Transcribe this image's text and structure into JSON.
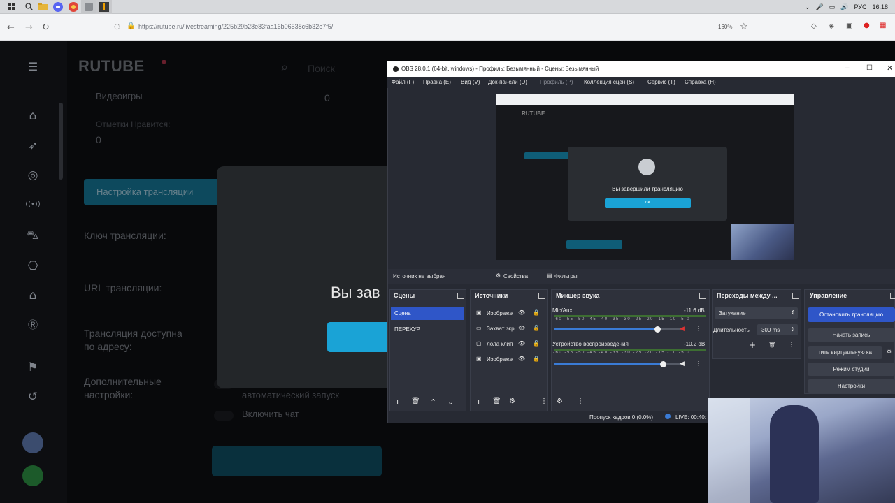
{
  "taskbar": {
    "tray": {
      "lang": "РУС",
      "time": "16:18"
    }
  },
  "browser": {
    "url": "https://rutube.ru/livestreaming/225b29b28e83faa16b06538c6b32e7f5/",
    "zoom": "160%"
  },
  "rutube": {
    "logo": "RUTUBE",
    "search_placeholder": "Поиск",
    "stats": {
      "videogames_label": "Видеоигры",
      "videogames_value": "0",
      "likes_label": "Отметки Нравится:",
      "likes_value": "0"
    },
    "tab_settings": "Настройка трансляции",
    "labels": {
      "key": "Ключ трансляции:",
      "url": "URL трансляции:",
      "address_1": "Трансляция доступна",
      "address_2": "по адресу:",
      "extra_1": "Дополнительные",
      "extra_2": "настройки:"
    },
    "toggles": {
      "autostart": "автоматический запуск",
      "chat": "Включить чат"
    },
    "modal_title": "Вы зав"
  },
  "obs": {
    "title": "OBS 28.0.1 (64-bit, windows) - Профиль: Безымянный - Сцены: Безымянный",
    "menu": [
      "Файл (F)",
      "Правка (E)",
      "Вид (V)",
      "Док-панели (D)",
      "Профиль (P)",
      "Коллекция сцен (S)",
      "Сервис (T)",
      "Справка (H)"
    ],
    "preview": {
      "logo": "RUTUBE",
      "modal_text": "Вы завершили трансляцию",
      "modal_btn": "ок"
    },
    "no_source": "Источник не выбран",
    "properties": "Свойства",
    "filters": "Фильтры",
    "scenes": {
      "title": "Сцены",
      "items": [
        "Сцена",
        "ПЕРЕКУР"
      ]
    },
    "sources": {
      "title": "Источники",
      "items": [
        {
          "label": "Изображе",
          "icon": "image-icon"
        },
        {
          "label": "Захват экр",
          "icon": "monitor-icon"
        },
        {
          "label": "лола клип",
          "icon": "media-icon"
        },
        {
          "label": "Изображе",
          "icon": "image-icon"
        }
      ]
    },
    "mixer": {
      "title": "Микшер звука",
      "ticks": "-60 -55 -50 -45 -40 -35 -30 -25 -20 -15 -10 -5 0",
      "channels": [
        {
          "name": "Mic/Aux",
          "db": "-11.6 dB",
          "level": 0.82
        },
        {
          "name": "Устройство воспроизведения",
          "db": "-10.2 dB",
          "level": 0.86
        }
      ]
    },
    "transitions": {
      "title": "Переходы между ...",
      "type": "Затухание",
      "duration_label": "Длительность",
      "duration_value": "300 ms"
    },
    "controls": {
      "title": "Управление",
      "stop_stream": "Остановить трансляцию",
      "start_record": "Начать запись",
      "virtual_cam": "тить виртуальную ка",
      "studio_mode": "Режим студии",
      "settings": "Настройки"
    },
    "status": {
      "dropped": "Пропуск кадров 0 (0.0%)",
      "live": "LIVE: 00:40:"
    }
  },
  "colors": {
    "accent": "#1aa3d6",
    "obs_bg": "#272a33",
    "obs_selected": "#2f56c8"
  }
}
